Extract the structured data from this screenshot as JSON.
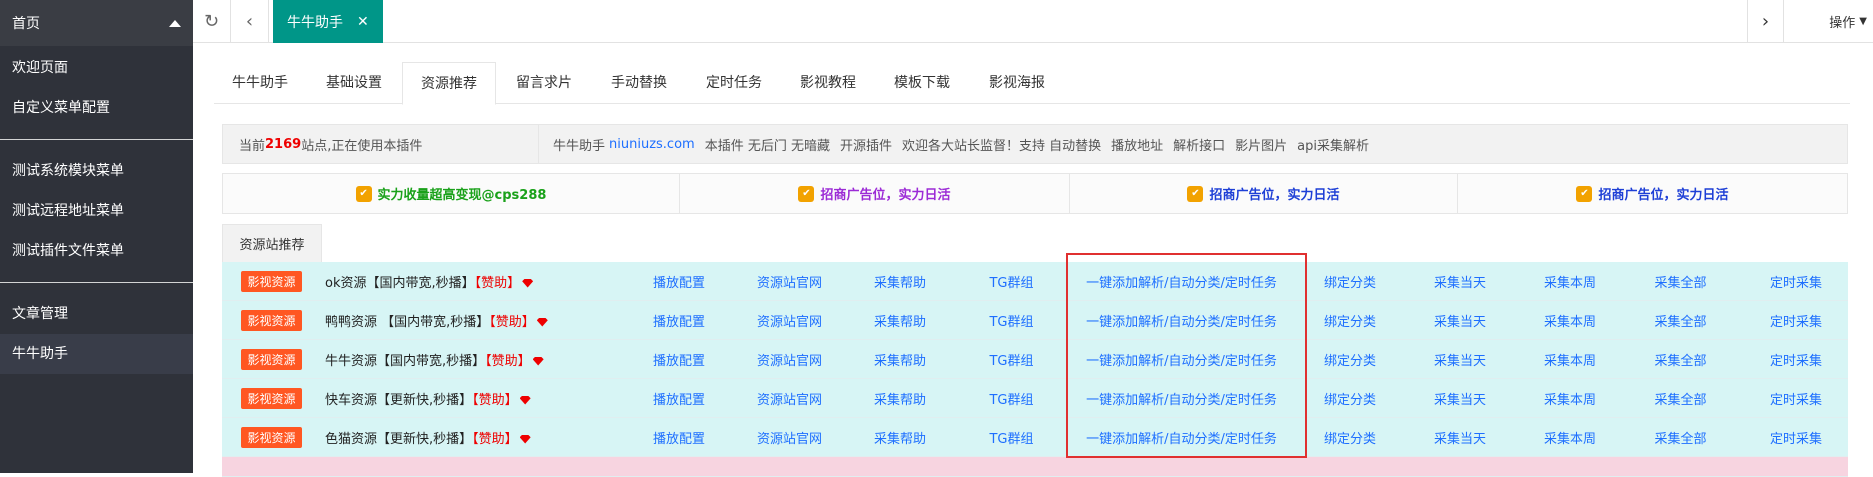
{
  "sidebar": {
    "top_label": "首页",
    "items": [
      {
        "label": "欢迎页面"
      },
      {
        "label": "自定义菜单配置"
      },
      {
        "label": "测试系统模块菜单"
      },
      {
        "label": "测试远程地址菜单"
      },
      {
        "label": "测试插件文件菜单"
      },
      {
        "label": "文章管理"
      },
      {
        "label": "牛牛助手"
      }
    ]
  },
  "topbar": {
    "refresh_icon": "refresh-icon",
    "back_icon": "chevron-left-icon",
    "open_tab": "牛牛助手",
    "close_icon": "close-icon",
    "forward_icon": "chevron-right-icon",
    "ops_label": "操作",
    "accent": "#009688"
  },
  "tabs": [
    {
      "label": "牛牛助手"
    },
    {
      "label": "基础设置"
    },
    {
      "label": "资源推荐",
      "active": true
    },
    {
      "label": "留言求片"
    },
    {
      "label": "手动替换"
    },
    {
      "label": "定时任务"
    },
    {
      "label": "影视教程"
    },
    {
      "label": "模板下载"
    },
    {
      "label": "影视海报"
    }
  ],
  "info": {
    "prefix": "当前",
    "count": "2169",
    "suffix": "站点,正在使用本插件",
    "brand": "牛牛助手",
    "site": "niuniuzs.com",
    "desc": "本插件 无后门 无暗藏",
    "open": "开源插件",
    "welcome": "欢迎各大站长监督！支持 自动替换",
    "features": [
      "播放地址",
      "解析接口",
      "影片图片",
      "api采集解析"
    ]
  },
  "ads": [
    {
      "text": "实力收量超高变现@cps288",
      "color": "#1aa11a"
    },
    {
      "text": "招商广告位，实力日活",
      "color": "#9c2bd6"
    },
    {
      "text": "招商广告位，实力日活",
      "color": "#1e3fd6"
    },
    {
      "text": "招商广告位，实力日活",
      "color": "#1e3fd6"
    }
  ],
  "recommend_tab": "资源站推荐",
  "table": {
    "tag": "影视资源",
    "sponsor": "【赞助】",
    "actions": [
      "播放配置",
      "资源站官网",
      "采集帮助",
      "TG群组",
      "一键添加解析/自动分类/定时任务",
      "绑定分类",
      "采集当天",
      "采集本周",
      "采集全部",
      "定时采集"
    ],
    "rows": [
      {
        "name": "ok资源【国内带宽,秒播】"
      },
      {
        "name": "鸭鸭资源 【国内带宽,秒播】"
      },
      {
        "name": "牛牛资源【国内带宽,秒播】"
      },
      {
        "name": "快车资源【更新快,秒播】"
      },
      {
        "name": "色猫资源【更新快,秒播】"
      }
    ]
  }
}
